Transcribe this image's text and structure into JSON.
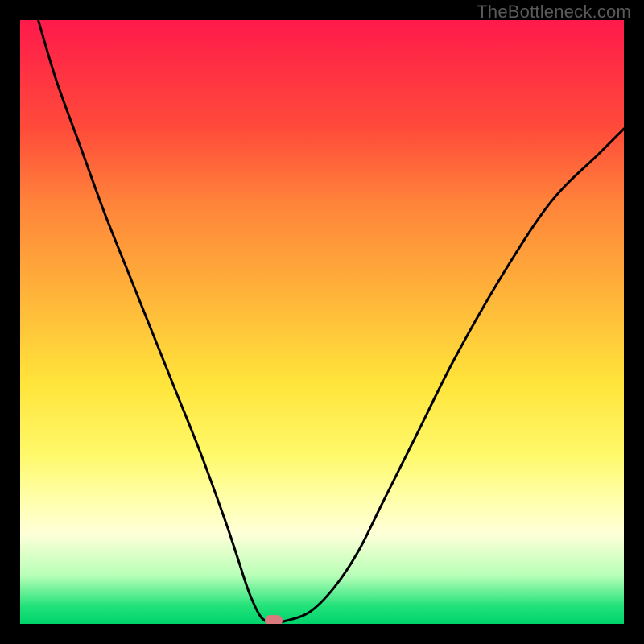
{
  "watermark": "TheBottleneck.com",
  "chart_data": {
    "type": "line",
    "title": "",
    "xlabel": "",
    "ylabel": "",
    "xlim": [
      0,
      100
    ],
    "ylim": [
      0,
      100
    ],
    "gradient_stops": [
      {
        "pos": 0,
        "color": "#ff1a4b"
      },
      {
        "pos": 18,
        "color": "#ff4b3a"
      },
      {
        "pos": 30,
        "color": "#ff823a"
      },
      {
        "pos": 45,
        "color": "#ffb23a"
      },
      {
        "pos": 60,
        "color": "#ffe43a"
      },
      {
        "pos": 72,
        "color": "#fff96a"
      },
      {
        "pos": 80,
        "color": "#ffffb0"
      },
      {
        "pos": 85,
        "color": "#ffffd8"
      },
      {
        "pos": 92,
        "color": "#b8ffb8"
      },
      {
        "pos": 97,
        "color": "#23e27a"
      },
      {
        "pos": 100,
        "color": "#00d36b"
      }
    ],
    "series": [
      {
        "name": "bottleneck-curve",
        "x": [
          3,
          6,
          10,
          14,
          18,
          22,
          26,
          30,
          34,
          36,
          38,
          40,
          42,
          44,
          48,
          52,
          56,
          60,
          66,
          72,
          80,
          88,
          96,
          100
        ],
        "y": [
          100,
          90,
          79,
          68,
          58,
          48,
          38,
          28,
          17,
          11,
          5,
          1,
          0.3,
          0.5,
          2,
          6,
          12,
          20,
          32,
          44,
          58,
          70,
          78,
          82
        ]
      }
    ],
    "marker": {
      "x": 42,
      "y": 0.5,
      "color": "#d97a7f"
    }
  }
}
